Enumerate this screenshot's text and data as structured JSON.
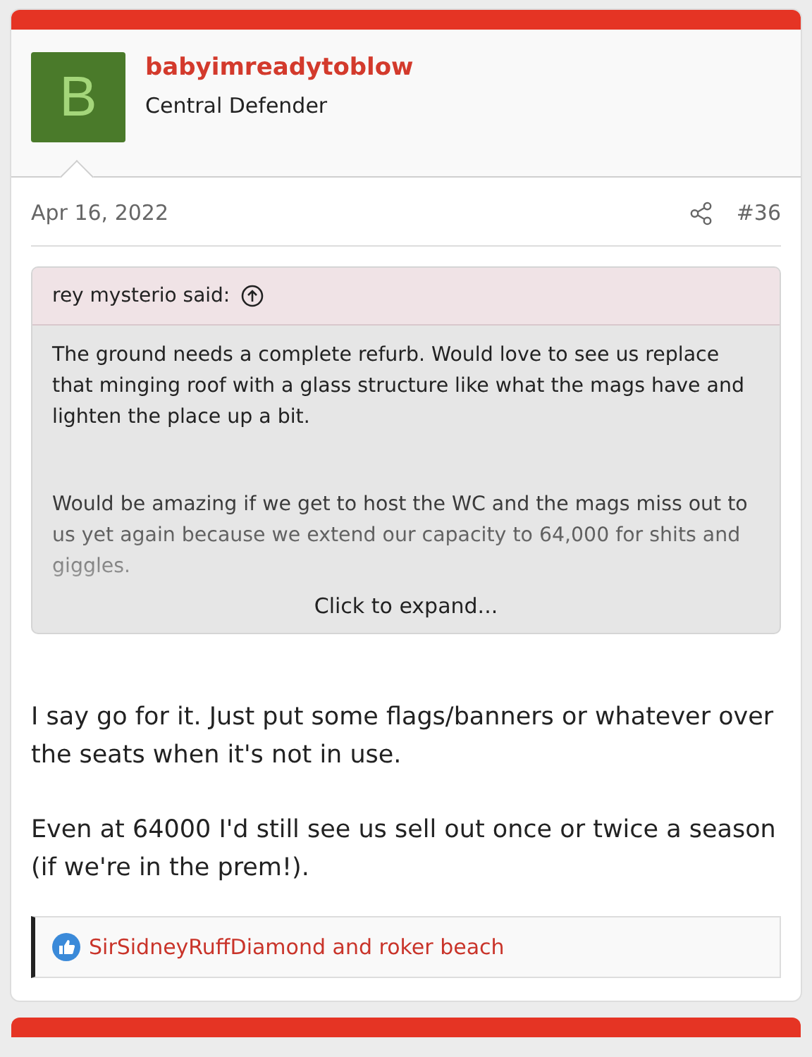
{
  "post": {
    "avatar_letter": "B",
    "username": "babyimreadytoblow",
    "user_title": "Central Defender",
    "date": "Apr 16, 2022",
    "post_number": "#36",
    "quote": {
      "attribution": "rey mysterio said:",
      "paragraphs": [
        "The ground needs a complete refurb. Would love to see us replace that minging roof with a glass structure like what the mags have and lighten the place up a bit.",
        "Would be amazing if we get to host the WC and the mags miss out to us yet again because we extend our capacity to 64,000 for shits and giggles."
      ],
      "expand": "Click to expand..."
    },
    "paragraphs": [
      "I say go for it. Just put some flags/banners or whatever over the seats when it's not in use.",
      "Even at 64000 I'd still see us sell out once or twice a season (if we're in the prem!)."
    ],
    "reactions": "SirSidneyRuffDiamond and roker beach"
  }
}
